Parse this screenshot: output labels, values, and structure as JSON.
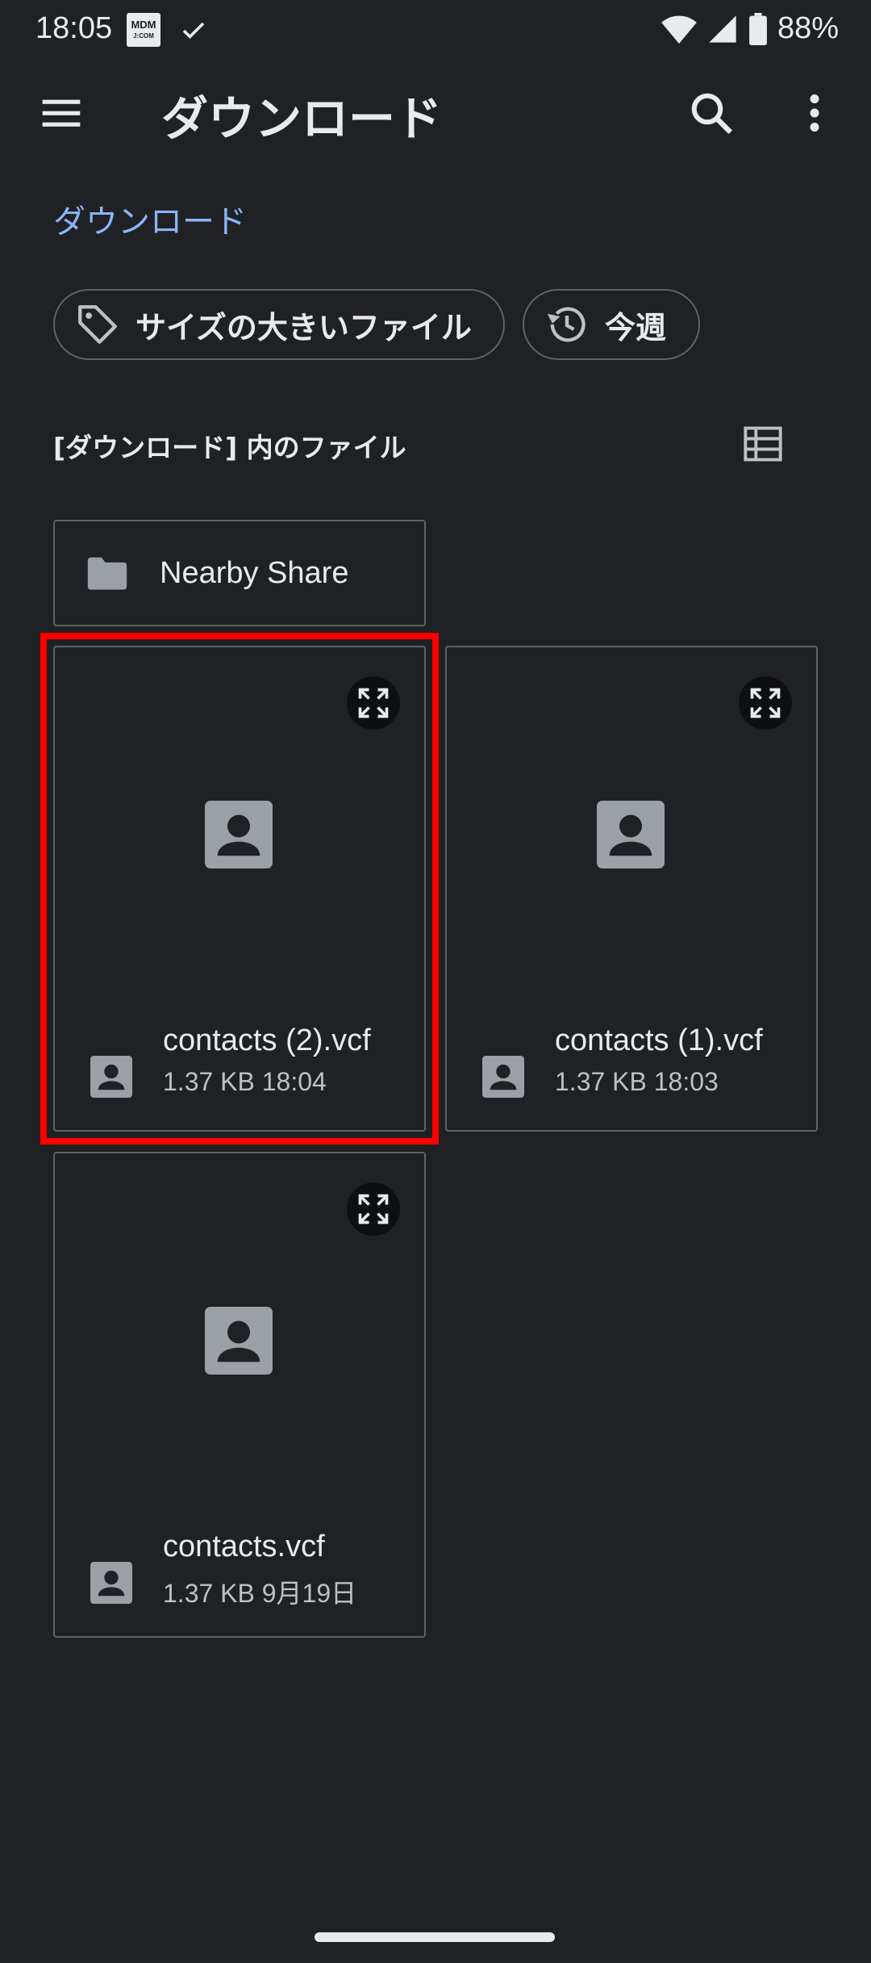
{
  "status_bar": {
    "time": "18:05",
    "mdm_top": "MDM",
    "mdm_bottom": "J:COM",
    "battery": "88%"
  },
  "app_bar": {
    "title": "ダウンロード"
  },
  "breadcrumb": "ダウンロード",
  "chips": [
    {
      "label": "サイズの大きいファイル",
      "icon": "tag-icon"
    },
    {
      "label": "今週",
      "icon": "history-icon"
    }
  ],
  "section_title": "[ダウンロード] 内のファイル",
  "folder": {
    "name": "Nearby Share",
    "icon": "folder-icon"
  },
  "files": [
    {
      "name": "contacts (2).vcf",
      "size": "1.37 KB",
      "date": "18:04",
      "meta": "1.37 KB  18:04",
      "icon": "contact-icon"
    },
    {
      "name": "contacts (1).vcf",
      "size": "1.37 KB",
      "date": "18:03",
      "meta": "1.37 KB  18:03",
      "icon": "contact-icon"
    },
    {
      "name": "contacts.vcf",
      "size": "1.37 KB",
      "date": "9月19日",
      "meta": "1.37 KB  9月19日",
      "icon": "contact-icon"
    }
  ],
  "colors": {
    "background": "#202124",
    "accent": "#8ab4f8",
    "highlight": "#ff0000",
    "border": "#5f6368"
  }
}
